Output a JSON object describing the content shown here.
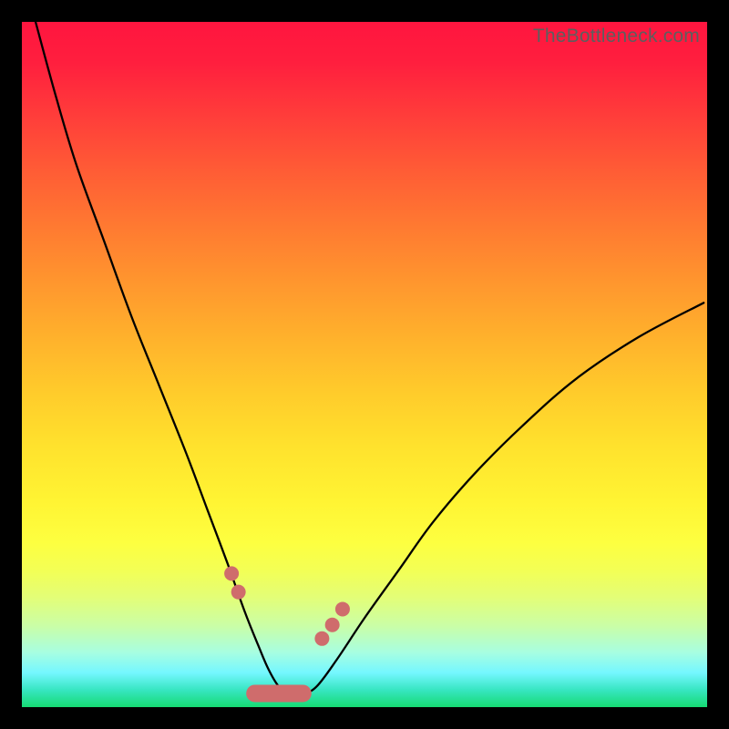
{
  "watermark": "TheBottleneck.com",
  "colors": {
    "marker": "#cf6c6c",
    "curve": "#000000"
  },
  "chart_data": {
    "type": "line",
    "title": "",
    "xlabel": "",
    "ylabel": "",
    "xlim": [
      0,
      100
    ],
    "ylim": [
      0,
      100
    ],
    "series": [
      {
        "name": "bottleneck-curve",
        "x": [
          2,
          5,
          8,
          12,
          16,
          20,
          24,
          27,
          30,
          32.5,
          34.5,
          36,
          37.5,
          39,
          41,
          43,
          46,
          50,
          55,
          60,
          66,
          73,
          81,
          90,
          99.5
        ],
        "y": [
          100,
          89,
          79,
          68,
          57,
          47,
          37,
          29,
          21,
          14,
          9,
          5.5,
          3,
          2,
          2,
          3,
          7,
          13,
          20,
          27,
          34,
          41,
          48,
          54,
          59
        ]
      }
    ],
    "markers": {
      "left": [
        {
          "x": 30.6,
          "y": 19.5
        },
        {
          "x": 31.6,
          "y": 16.8
        }
      ],
      "right": [
        {
          "x": 43.8,
          "y": 10.0
        },
        {
          "x": 45.3,
          "y": 12.0
        },
        {
          "x": 46.8,
          "y": 14.3
        }
      ],
      "floor": [
        {
          "x": 34.0,
          "y": 3.0
        },
        {
          "x": 41.0,
          "y": 3.0
        }
      ]
    }
  }
}
